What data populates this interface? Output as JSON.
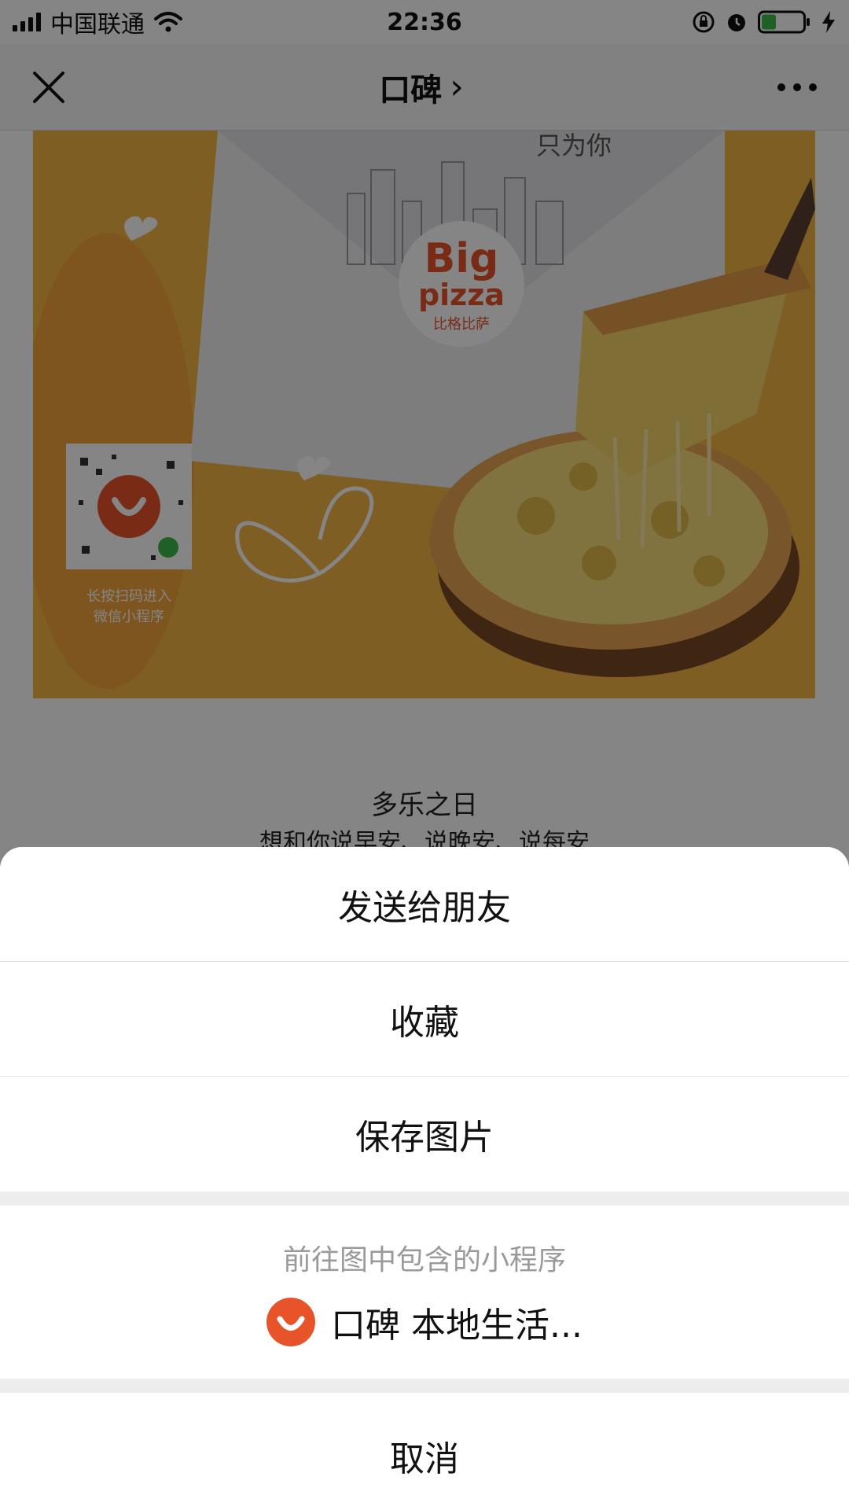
{
  "status_bar": {
    "carrier": "中国联通",
    "time": "22:36"
  },
  "nav": {
    "title": "口碑",
    "title_chevron": "›",
    "close_icon": "close-icon",
    "more_icon": "more-icon"
  },
  "poster": {
    "brand_top": "Big",
    "brand_bottom": "pizza",
    "brand_cn": "比格比萨",
    "handwriting": "只为你",
    "qr_caption_line1": "长按扫码进入",
    "qr_caption_line2": "微信小程序"
  },
  "article": {
    "headline": "多乐之日",
    "subline": "想和你说早安、说晚安、说每安"
  },
  "action_sheet": {
    "send_to_friend": "发送给朋友",
    "favorite": "收藏",
    "save_image": "保存图片",
    "mini_program_hint": "前往图中包含的小程序",
    "mini_program_name": "口碑 本地生活...",
    "cancel": "取消"
  },
  "colors": {
    "koubei_orange": "#e8542a",
    "poster_bg": "#f3b445",
    "pizza_brand": "#e8542a"
  }
}
